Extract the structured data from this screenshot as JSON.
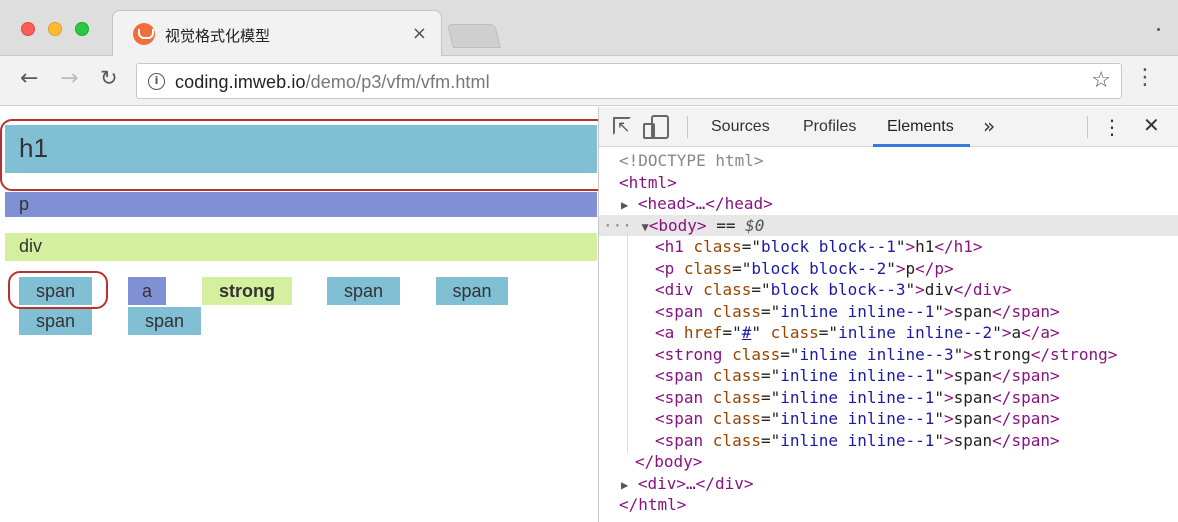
{
  "browser": {
    "tab_title": "视觉格式化模型",
    "tab_close": "×",
    "url_host": "coding.imweb.io",
    "url_path": "/demo/p3/vfm/vfm.html",
    "icons": [
      "favicon-icon",
      "back-arrow-icon",
      "forward-arrow-icon",
      "reload-icon",
      "info-icon",
      "star-icon",
      "kebab-menu-icon"
    ]
  },
  "page": {
    "h1": "h1",
    "p": "p",
    "div": "div",
    "inline_items": [
      "span",
      "a",
      "strong",
      "span",
      "span",
      "span",
      "span"
    ],
    "colors": {
      "block_1": "#80bfd4",
      "block_2": "#8090d4",
      "block_3": "#d4f09e",
      "annotation": "#b5322e"
    }
  },
  "devtools": {
    "tabs": [
      "Sources",
      "Profiles",
      "Elements"
    ],
    "active_tab": "Elements",
    "more": "»",
    "kebab": "⋮",
    "close": "✕",
    "dom": {
      "doctype": "<!DOCTYPE html>",
      "html_open": "<html>",
      "head": "<head>…</head>",
      "body_open": "<body>",
      "body_marker": " == ",
      "body_var": "$0",
      "children": [
        {
          "tag": "h1",
          "attr": "class",
          "value": "block block--1",
          "text": "h1"
        },
        {
          "tag": "p",
          "attr": "class",
          "value": "block block--2",
          "text": "p"
        },
        {
          "tag": "div",
          "attr": "class",
          "value": "block block--3",
          "text": "div"
        },
        {
          "tag": "span",
          "attr": "class",
          "value": "inline inline--1",
          "text": "span"
        },
        {
          "tag": "a",
          "attr": "href",
          "value": "#",
          "attr2": "class",
          "value2": "inline inline--2",
          "text": "a"
        },
        {
          "tag": "strong",
          "attr": "class",
          "value": "inline inline--3",
          "text": "strong"
        },
        {
          "tag": "span",
          "attr": "class",
          "value": "inline inline--1",
          "text": "span"
        },
        {
          "tag": "span",
          "attr": "class",
          "value": "inline inline--1",
          "text": "span"
        },
        {
          "tag": "span",
          "attr": "class",
          "value": "inline inline--1",
          "text": "span"
        },
        {
          "tag": "span",
          "attr": "class",
          "value": "inline inline--1",
          "text": "span"
        }
      ],
      "body_close": "</body>",
      "div_collapsed": "<div>…</div>",
      "html_close": "</html>"
    }
  }
}
